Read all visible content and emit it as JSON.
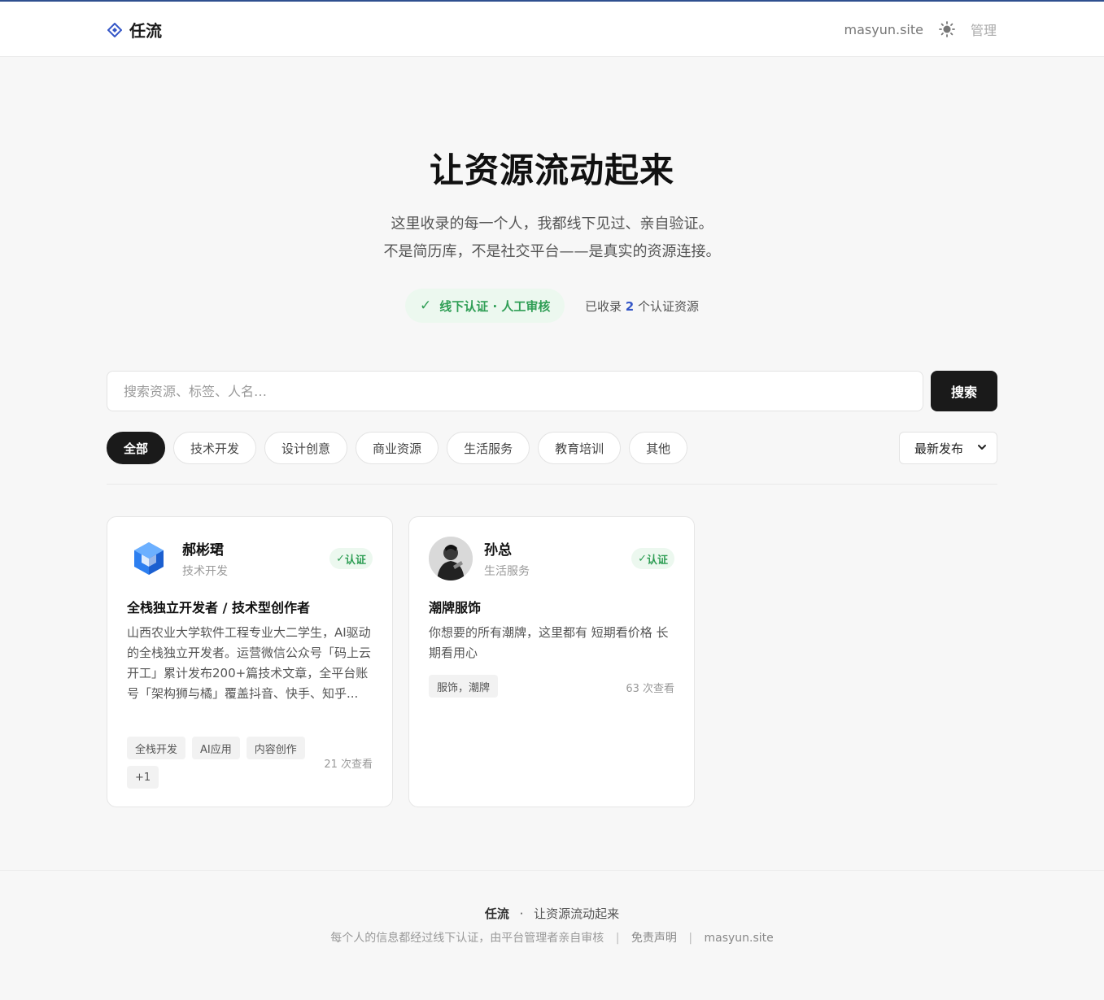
{
  "header": {
    "brand": "任流",
    "site_link": "masyun.site",
    "admin_link": "管理"
  },
  "hero": {
    "title": "让资源流动起来",
    "subtitle_line1": "这里收录的每一个人，我都线下见过、亲自验证。",
    "subtitle_line2": "不是简历库，不是社交平台——是真实的资源连接。",
    "verify_badge": "线下认证 · 人工审核",
    "stat_prefix": "已收录",
    "stat_count": "2",
    "stat_suffix": "个认证资源"
  },
  "search": {
    "placeholder": "搜索资源、标签、人名…",
    "button": "搜索"
  },
  "filters": {
    "categories": [
      "全部",
      "技术开发",
      "设计创意",
      "商业资源",
      "生活服务",
      "教育培训",
      "其他"
    ],
    "active": "全部",
    "sort_label": "最新发布"
  },
  "cards": [
    {
      "name": "郝彬珺",
      "category": "技术开发",
      "badge": "认证",
      "title": "全栈独立开发者 / 技术型创作者",
      "description": "山西农业大学软件工程专业大二学生，AI驱动的全栈独立开发者。运营微信公众号「码上云开工」累计发布200+篇技术文章，全平台账号「架构狮与橘」覆盖抖音、快手、知乎...",
      "tags": [
        "全栈开发",
        "AI应用",
        "内容创作",
        "+1"
      ],
      "views": "21 次查看"
    },
    {
      "name": "孙总",
      "category": "生活服务",
      "badge": "认证",
      "title": "潮牌服饰",
      "description": "你想要的所有潮牌，这里都有 短期看价格 长期看用心",
      "tags": [
        "服饰，潮牌"
      ],
      "views": "63 次查看"
    }
  ],
  "footer": {
    "brand": "任流",
    "dot": "·",
    "tagline": "让资源流动起来",
    "note": "每个人的信息都经过线下认证，由平台管理者亲自审核",
    "disclaimer": "免责声明",
    "site": "masyun.site"
  },
  "colors": {
    "accent_blue": "#3456c7",
    "verify_green": "#2f9e55",
    "primary_dark": "#1a1a1a"
  }
}
